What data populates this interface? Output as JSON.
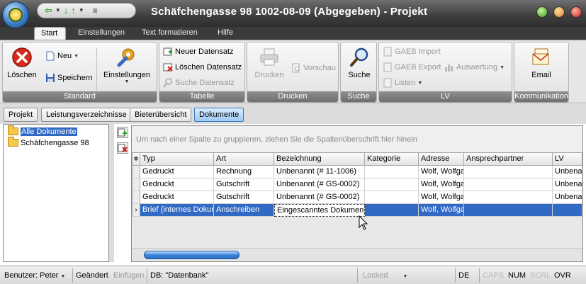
{
  "window": {
    "title": "Schäfchengasse 98 1002-08-09 (Abgegeben) - Projekt"
  },
  "ribbon_tabs": [
    "Start",
    "Einstellungen",
    "Text formatieren",
    "Hilfe"
  ],
  "ribbon": {
    "standard": {
      "label": "Standard",
      "loeschen": "Löschen",
      "neu": "Neu",
      "speichern": "Speichern",
      "einstellungen": "Einstellungen"
    },
    "tabelle": {
      "label": "Tabelle",
      "neuer_datensatz": "Neuer Datensatz",
      "loeschen_datensatz": "Löschen Datensatz",
      "suche_datensatz": "Suche Datensatz"
    },
    "drucken": {
      "label": "Drucken",
      "drucken": "Drucken",
      "vorschau": "Vorschau"
    },
    "suche": {
      "label": "Suche",
      "suche": "Suche"
    },
    "lv": {
      "label": "LV",
      "gaeb_import": "GAEB Import",
      "gaeb_export": "GAEB Export",
      "auswertung": "Auswertung",
      "listen": "Listen"
    },
    "kommunikation": {
      "label": "Kommunikation",
      "email": "Email"
    }
  },
  "doc_tabs": [
    "Projekt",
    "Leistungsverzeichnisse",
    "Bieterübersicht",
    "Dokumente"
  ],
  "tree": {
    "items": [
      "Alle Dokumente",
      "Schäfchengasse 98"
    ]
  },
  "grid": {
    "group_hint": "Um nach einer Spalte zu gruppieren, ziehen Sie die Spaltenüberschrift hier hinein",
    "columns": [
      "Typ",
      "Art",
      "Bezeichnung",
      "Kategorie",
      "Adresse",
      "Ansprechpartner",
      "LV"
    ],
    "rows": [
      [
        "Gedruckt",
        "Rechnung",
        "Unbenannt (# 11-1006)",
        "",
        "Wolf, Wolfgang",
        "",
        "Unbenannt"
      ],
      [
        "Gedruckt",
        "Gutschrift",
        "Unbenannt (# GS-0002)",
        "",
        "Wolf, Wolfgang",
        "",
        "Unbenannt"
      ],
      [
        "Gedruckt",
        "Gutschrift",
        "Unbenannt (# GS-0002)",
        "",
        "Wolf, Wolfgang",
        "",
        "Unbenannt"
      ],
      [
        "Brief (internes Dokument)",
        "Anschreiben",
        "Eingescanntes Dokument",
        "",
        "Wolf, Wolfgang",
        "",
        ""
      ]
    ],
    "selected_row": 3
  },
  "status": {
    "benutzer": "Benutzer: Peter",
    "geaendert": "Geändert",
    "einfuegen": "Einfügen",
    "db": "DB: \"Datenbank\"",
    "locked": "Locked",
    "lang": "DE",
    "caps": "CAPS",
    "num": "NUM",
    "scrl": "SCRL",
    "ovr": "OVR"
  },
  "colors": {
    "selection": "#316ac5",
    "title_bar": "#3d3d3d",
    "ribbon_group_label": "#7a7a7a",
    "active_doc_tab": "#9ccaf5"
  }
}
